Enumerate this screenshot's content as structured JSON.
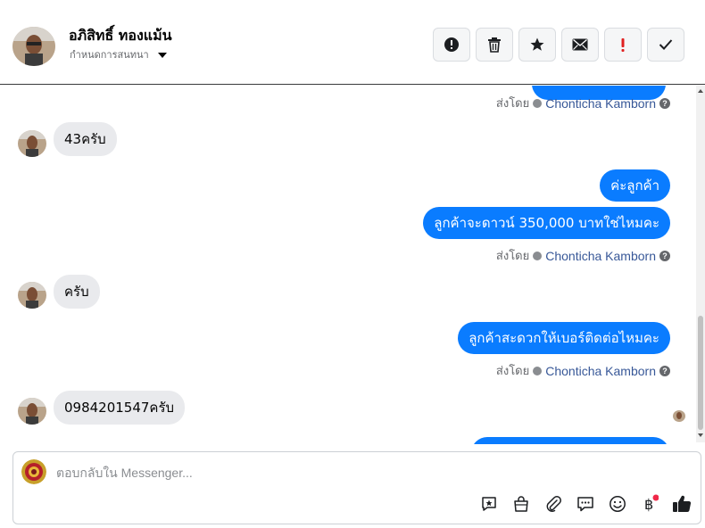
{
  "header": {
    "name": "อภิสิทธิ์ ทองแม้น",
    "subtitle": "กำหนดการสนทนา",
    "actions": [
      {
        "name": "spam-button",
        "icon": "exclamation-circle-icon"
      },
      {
        "name": "delete-button",
        "icon": "trash-icon"
      },
      {
        "name": "star-button",
        "icon": "star-icon"
      },
      {
        "name": "mark-unread-button",
        "icon": "envelope-icon"
      },
      {
        "name": "follow-up-button",
        "icon": "red-exclamation-icon"
      },
      {
        "name": "done-button",
        "icon": "check-icon"
      }
    ]
  },
  "messages": {
    "sent_by_label": "ส่งโดย",
    "agent_name": "Chonticha Kamborn",
    "in_1": "43ครับ",
    "out_1": "ค่ะลูกค้า",
    "out_2": "ลูกค้าจะดาวน์ 350,000 บาทใช่ไหมคะ",
    "in_2": "ครับ",
    "out_3": "ลูกค้าสะดวกให้เบอร์ติดต่อไหมคะ",
    "in_3": "0984201547ครับ"
  },
  "composer": {
    "placeholder": "ตอบกลับใน Messenger...",
    "tools": [
      "saved-reply-icon",
      "shopping-bag-icon",
      "paperclip-icon",
      "chat-bubble-icon",
      "emoji-icon",
      "baht-payment-icon",
      "like-thumb-icon"
    ]
  },
  "colors": {
    "outgoing_bubble": "#0a7cff",
    "incoming_bubble": "#e9eaed",
    "agent_link": "#385898",
    "alert_red": "#e02020",
    "notification_dot": "#f02849"
  }
}
